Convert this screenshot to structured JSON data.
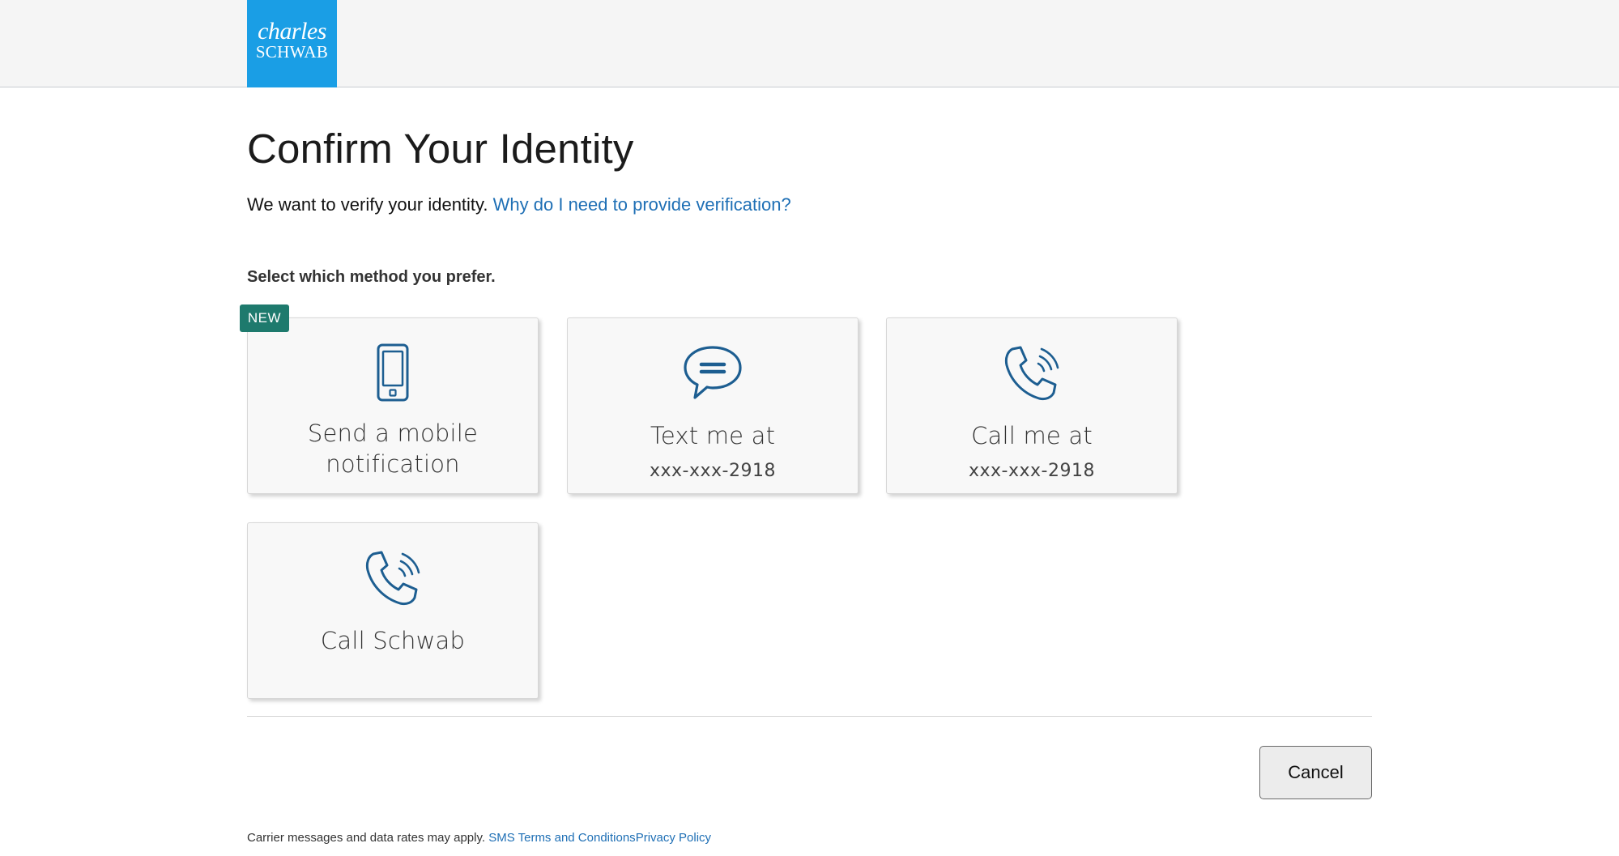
{
  "brand": {
    "line1": "charles",
    "line2": "SCHWAB",
    "color": "#1a9ee5"
  },
  "page": {
    "title": "Confirm Your Identity",
    "intro_text": "We want to verify your identity.",
    "intro_link": "Why do I need to provide verification?",
    "prompt": "Select which method you prefer."
  },
  "badge": "NEW",
  "methods": [
    {
      "icon": "mobile-phone-icon",
      "title_line1": "Send a mobile",
      "title_line2": "notification"
    },
    {
      "icon": "chat-bubble-icon",
      "title": "Text me at",
      "detail": "xxx-xxx-2918"
    },
    {
      "icon": "phone-call-icon",
      "title": "Call me at",
      "detail": "xxx-xxx-2918"
    },
    {
      "icon": "phone-call-icon",
      "title": "Call Schwab"
    }
  ],
  "actions": {
    "cancel": "Cancel"
  },
  "footer": {
    "note": "Carrier messages and data rates may apply.",
    "sms_terms": "SMS Terms and Conditions",
    "privacy": "Privacy Policy"
  },
  "colors": {
    "accent": "#1e6fb5",
    "icon": "#1d5e91",
    "badge": "#1e7a6d"
  }
}
